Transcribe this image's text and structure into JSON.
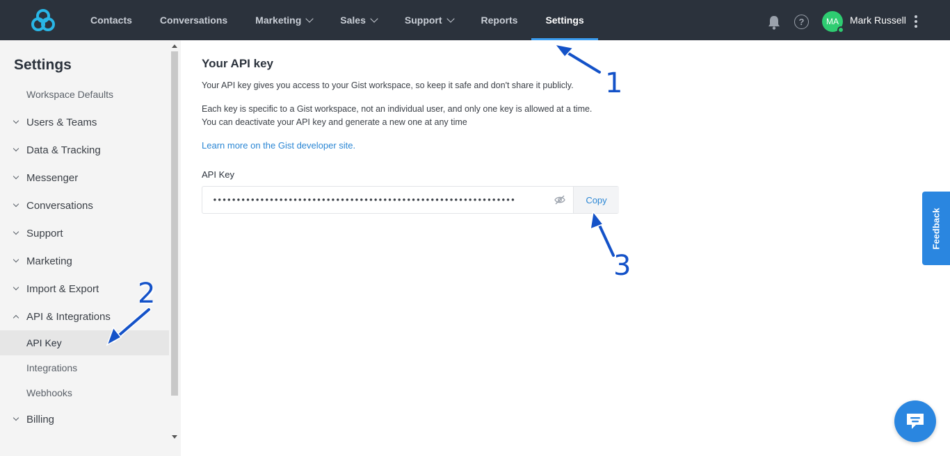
{
  "topbar": {
    "nav": [
      {
        "label": "Contacts",
        "has_dropdown": false,
        "active": false
      },
      {
        "label": "Conversations",
        "has_dropdown": false,
        "active": false
      },
      {
        "label": "Marketing",
        "has_dropdown": true,
        "active": false
      },
      {
        "label": "Sales",
        "has_dropdown": true,
        "active": false
      },
      {
        "label": "Support",
        "has_dropdown": true,
        "active": false
      },
      {
        "label": "Reports",
        "has_dropdown": false,
        "active": false
      },
      {
        "label": "Settings",
        "has_dropdown": false,
        "active": true
      }
    ],
    "help_glyph": "?",
    "avatar_initials": "MA",
    "user_name": "Mark Russell",
    "colors": {
      "bar": "#2b323c",
      "accent": "#3b9df0",
      "avatar": "#2ecc71"
    }
  },
  "sidebar": {
    "title": "Settings",
    "items": [
      {
        "label": "Workspace Defaults",
        "type": "sub"
      },
      {
        "label": "Users & Teams",
        "type": "group",
        "expanded": false
      },
      {
        "label": "Data & Tracking",
        "type": "group",
        "expanded": false
      },
      {
        "label": "Messenger",
        "type": "group",
        "expanded": false
      },
      {
        "label": "Conversations",
        "type": "group",
        "expanded": false
      },
      {
        "label": "Support",
        "type": "group",
        "expanded": false
      },
      {
        "label": "Marketing",
        "type": "group",
        "expanded": false
      },
      {
        "label": "Import & Export",
        "type": "group",
        "expanded": false
      },
      {
        "label": "API & Integrations",
        "type": "group",
        "expanded": true
      },
      {
        "label": "API Key",
        "type": "sub",
        "selected": true
      },
      {
        "label": "Integrations",
        "type": "sub"
      },
      {
        "label": "Webhooks",
        "type": "sub"
      },
      {
        "label": "Billing",
        "type": "group",
        "expanded": false
      }
    ]
  },
  "main": {
    "heading": "Your API key",
    "intro": "Your API key gives you access to your Gist workspace, so keep it safe and don't share it publicly.",
    "detail_line1": "Each key is specific to a Gist workspace, not an individual user, and only one key is allowed at a time.",
    "detail_line2": "You can deactivate your API key and generate a new one at any time",
    "learn_more": "Learn more on the Gist developer site.",
    "field_label": "API Key",
    "api_key_masked": "••••••••••••••••••••••••••••••••••••••••••••••••••••••••••••••••",
    "copy_label": "Copy",
    "link_color": "#2a86d4"
  },
  "widgets": {
    "feedback_label": "Feedback",
    "color": "#2a86e0"
  },
  "annotations": {
    "markers": [
      "1",
      "2",
      "3"
    ],
    "color": "#1452c8"
  }
}
